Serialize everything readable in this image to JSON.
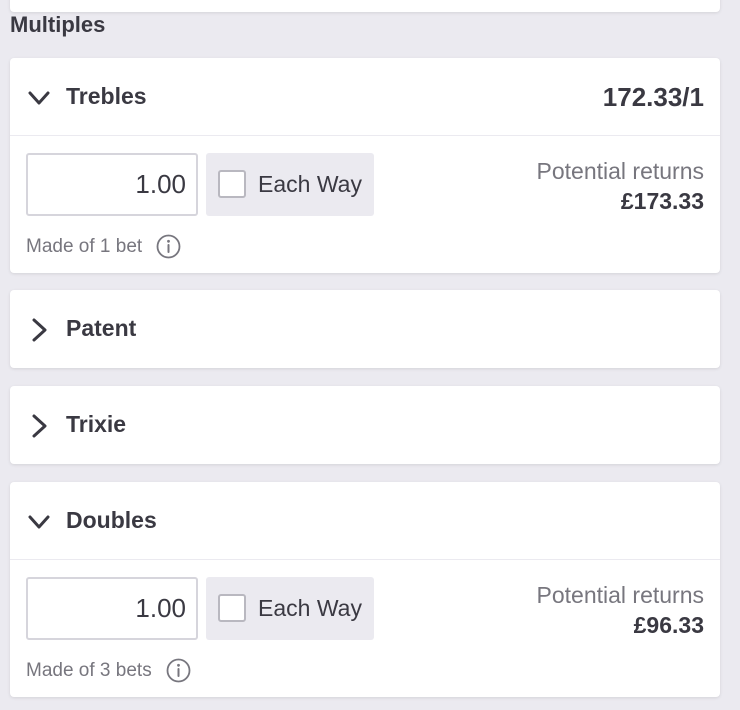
{
  "section": {
    "title": "Multiples"
  },
  "colors": {
    "page_bg": "#ebeaf0",
    "card_bg": "#ffffff",
    "text": "#3a3942",
    "muted_text": "#77767e"
  },
  "cards": [
    {
      "name": "Trebles",
      "expanded": true,
      "icon": "chevron-down-icon",
      "odds": "172.33/1",
      "stake_value": "1.00",
      "each_way_label": "Each Way",
      "each_way_checked": false,
      "returns_label": "Potential returns",
      "returns_value": "£173.33",
      "made_of": "Made of 1 bet",
      "info_icon": "info-icon"
    },
    {
      "name": "Patent",
      "expanded": false,
      "icon": "chevron-right-icon"
    },
    {
      "name": "Trixie",
      "expanded": false,
      "icon": "chevron-right-icon"
    },
    {
      "name": "Doubles",
      "expanded": true,
      "icon": "chevron-down-icon",
      "stake_value": "1.00",
      "each_way_label": "Each Way",
      "each_way_checked": false,
      "returns_label": "Potential returns",
      "returns_value": "£96.33",
      "made_of": "Made of 3 bets",
      "info_icon": "info-icon"
    }
  ]
}
